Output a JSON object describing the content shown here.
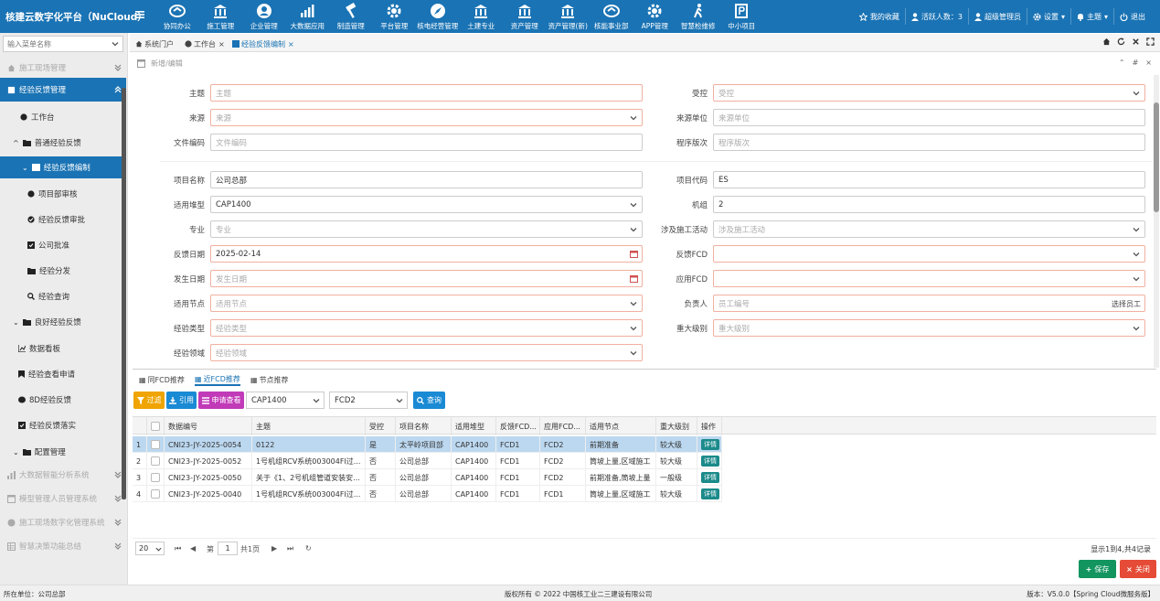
{
  "app": {
    "title": "核建云数字化平台（NuCloud）"
  },
  "topnav": [
    {
      "label": "协同办公",
      "icon": "handshake-icon"
    },
    {
      "label": "施工管理",
      "icon": "building-icon"
    },
    {
      "label": "企业管理",
      "icon": "user-circle-icon"
    },
    {
      "label": "大数据应用",
      "icon": "bar-chart-icon"
    },
    {
      "label": "制造管理",
      "icon": "hammer-icon"
    },
    {
      "label": "平台管理",
      "icon": "gear-icon"
    },
    {
      "label": "核电经营管理",
      "icon": "compass-icon"
    },
    {
      "label": "土建专业",
      "icon": "building-icon"
    },
    {
      "label": "资产管理",
      "icon": "building-icon"
    },
    {
      "label": "资产管理(新)",
      "icon": "building-icon"
    },
    {
      "label": "核能事业部",
      "icon": "handshake-icon"
    },
    {
      "label": "APP管理",
      "icon": "gear-icon"
    },
    {
      "label": "智慧检维修",
      "icon": "walker-icon"
    },
    {
      "label": "中小项目",
      "icon": "ruble-icon"
    }
  ],
  "topright": {
    "favorites": "我的收藏",
    "active_users": "活跃人数：3",
    "user": "超级管理员",
    "settings": "设置",
    "theme": "主题",
    "logout": "退出"
  },
  "sidebar": {
    "search_placeholder": "输入菜单名称",
    "items": [
      {
        "label": "施工现场管理"
      },
      {
        "label": "经验反馈管理"
      },
      {
        "label": "工作台"
      },
      {
        "label": "普通经验反馈"
      },
      {
        "label": "经验反馈编制"
      },
      {
        "label": "项目部审核"
      },
      {
        "label": "经验反馈审批"
      },
      {
        "label": "公司批准"
      },
      {
        "label": "经验分发"
      },
      {
        "label": "经验查询"
      },
      {
        "label": "良好经验反馈"
      },
      {
        "label": "数据看板"
      },
      {
        "label": "经验查看申请"
      },
      {
        "label": "8D经验反馈"
      },
      {
        "label": "经验反馈落实"
      },
      {
        "label": "配置管理"
      },
      {
        "label": "大数据智能分析系统"
      },
      {
        "label": "模型管理人员管理系统"
      },
      {
        "label": "施工现场数字化管理系统"
      },
      {
        "label": "智慧决策功能总结"
      }
    ]
  },
  "tabs": [
    {
      "label": "系统门户"
    },
    {
      "label": "工作台"
    },
    {
      "label": "经验反馈编制"
    }
  ],
  "panel": {
    "title": "新增/编辑"
  },
  "form": {
    "subject": {
      "label": "主题",
      "placeholder": "主题"
    },
    "controlled": {
      "label": "受控",
      "placeholder": "受控"
    },
    "source": {
      "label": "来源",
      "placeholder": "来源"
    },
    "source_unit": {
      "label": "来源单位",
      "placeholder": "来源单位"
    },
    "file_code": {
      "label": "文件编码",
      "placeholder": "文件编码"
    },
    "procedure_version": {
      "label": "程序版次",
      "placeholder": "程序版次"
    },
    "project_name": {
      "label": "项目名称",
      "value": "公司总部"
    },
    "project_code": {
      "label": "项目代码",
      "value": "ES"
    },
    "reactor_type": {
      "label": "适用堆型",
      "value": "CAP1400"
    },
    "unit": {
      "label": "机组",
      "value": "2"
    },
    "specialty": {
      "label": "专业",
      "placeholder": "专业"
    },
    "construction_activity": {
      "label": "涉及施工活动",
      "placeholder": "涉及施工活动"
    },
    "feedback_date": {
      "label": "反馈日期",
      "value": "2025-02-14"
    },
    "feedback_fcd": {
      "label": "反馈FCD",
      "value": ""
    },
    "occur_date": {
      "label": "发生日期",
      "placeholder": "发生日期"
    },
    "apply_fcd": {
      "label": "应用FCD",
      "value": ""
    },
    "apply_node": {
      "label": "适用节点",
      "placeholder": "适用节点"
    },
    "owner": {
      "label": "负责人",
      "placeholder": "员工编号",
      "pick": "选择员工"
    },
    "exp_type": {
      "label": "经验类型",
      "placeholder": "经验类型"
    },
    "severity": {
      "label": "重大级别",
      "placeholder": "重大级别"
    },
    "exp_field": {
      "label": "经验领域",
      "placeholder": "经验领域"
    }
  },
  "subtabs": [
    {
      "label": "同FCD推荐"
    },
    {
      "label": "近FCD推荐"
    },
    {
      "label": "节点推荐"
    }
  ],
  "toolbar": {
    "filter": "过滤",
    "cite": "引用",
    "apply_view": "申请查看",
    "reactor_select": "CAP1400",
    "fcd_select": "FCD2",
    "query": "查询"
  },
  "table": {
    "columns": [
      "数据编号",
      "主题",
      "受控",
      "项目名称",
      "适用堆型",
      "反馈FCD...",
      "应用FCD...",
      "适用节点",
      "重大级别",
      "操作"
    ],
    "rows": [
      {
        "no": "1",
        "code": "CNI23-JY-2025-0054",
        "subject": "0122",
        "controlled": "是",
        "project": "太平岭项目部",
        "reactor": "CAP1400",
        "ffcd": "FCD1",
        "afcd": "FCD2",
        "node": "前期准备",
        "level": "较大级",
        "action": "详情"
      },
      {
        "no": "2",
        "code": "CNI23-JY-2025-0052",
        "subject": "1号机组RCV系统003004FI过...",
        "controlled": "否",
        "project": "公司总部",
        "reactor": "CAP1400",
        "ffcd": "FCD1",
        "afcd": "FCD2",
        "node": "筒坡上量,区域施工",
        "level": "较大级",
        "action": "详情"
      },
      {
        "no": "3",
        "code": "CNI23-JY-2025-0050",
        "subject": "关于《1、2号机组管道安装安...",
        "controlled": "否",
        "project": "公司总部",
        "reactor": "CAP1400",
        "ffcd": "FCD1",
        "afcd": "FCD2",
        "node": "前期准备,筒坡上量",
        "level": "一般级",
        "action": "详情"
      },
      {
        "no": "4",
        "code": "CNI23-JY-2025-0040",
        "subject": "1号机组RCV系统003004FI过...",
        "controlled": "否",
        "project": "公司总部",
        "reactor": "CAP1400",
        "ffcd": "FCD1",
        "afcd": "FCD1",
        "node": "筒坡上量,区域施工",
        "level": "较大级",
        "action": "详情"
      }
    ]
  },
  "pager": {
    "size": "20",
    "page_prefix": "第",
    "page": "1",
    "page_total": "共1页",
    "info": "显示1到4,共4记录"
  },
  "actions": {
    "save": "保存",
    "close": "关闭"
  },
  "footer": {
    "unit": "所在单位：公司总部",
    "copyright": "版权所有 © 2022 中国核工业二三建设有限公司",
    "version": "版本：V5.0.0【Spring Cloud微服务版】"
  },
  "colors": {
    "primary": "#1a73b4",
    "filter": "#f0a400",
    "cite": "#1a8ad4",
    "apply": "#c13ab8",
    "save": "#12955f",
    "close": "#e54b36",
    "detail": "#1b8a8a"
  }
}
